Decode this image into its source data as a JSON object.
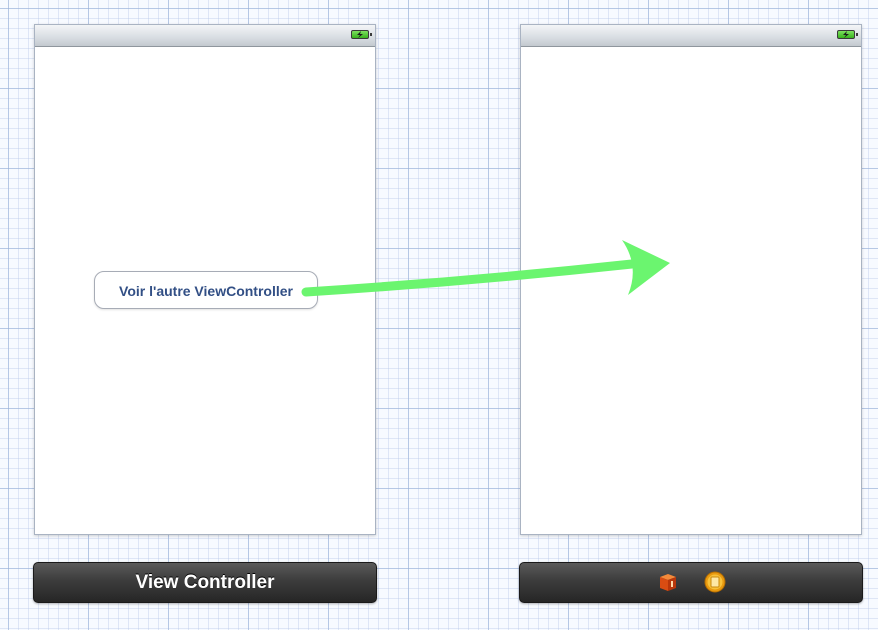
{
  "canvas": {
    "grid_color": "#b4c6e6",
    "background_color": "#f7faff"
  },
  "scenes": [
    {
      "status_bar": {
        "battery_icon": "battery-charging-icon",
        "battery_color": "#38b31d"
      },
      "button": {
        "label": "Voir l'autre ViewController",
        "text_color": "#324f85"
      },
      "dock": {
        "title": "View Controller"
      }
    },
    {
      "status_bar": {
        "battery_icon": "battery-charging-icon",
        "battery_color": "#38b31d"
      },
      "dock": {
        "title": "",
        "icons": [
          "view-controller-cube-icon",
          "first-responder-icon"
        ]
      }
    }
  ],
  "segue": {
    "icon": "segue-arrow",
    "color": "#6bf56f",
    "from": "Voir l'autre ViewController",
    "to": "second scene"
  }
}
